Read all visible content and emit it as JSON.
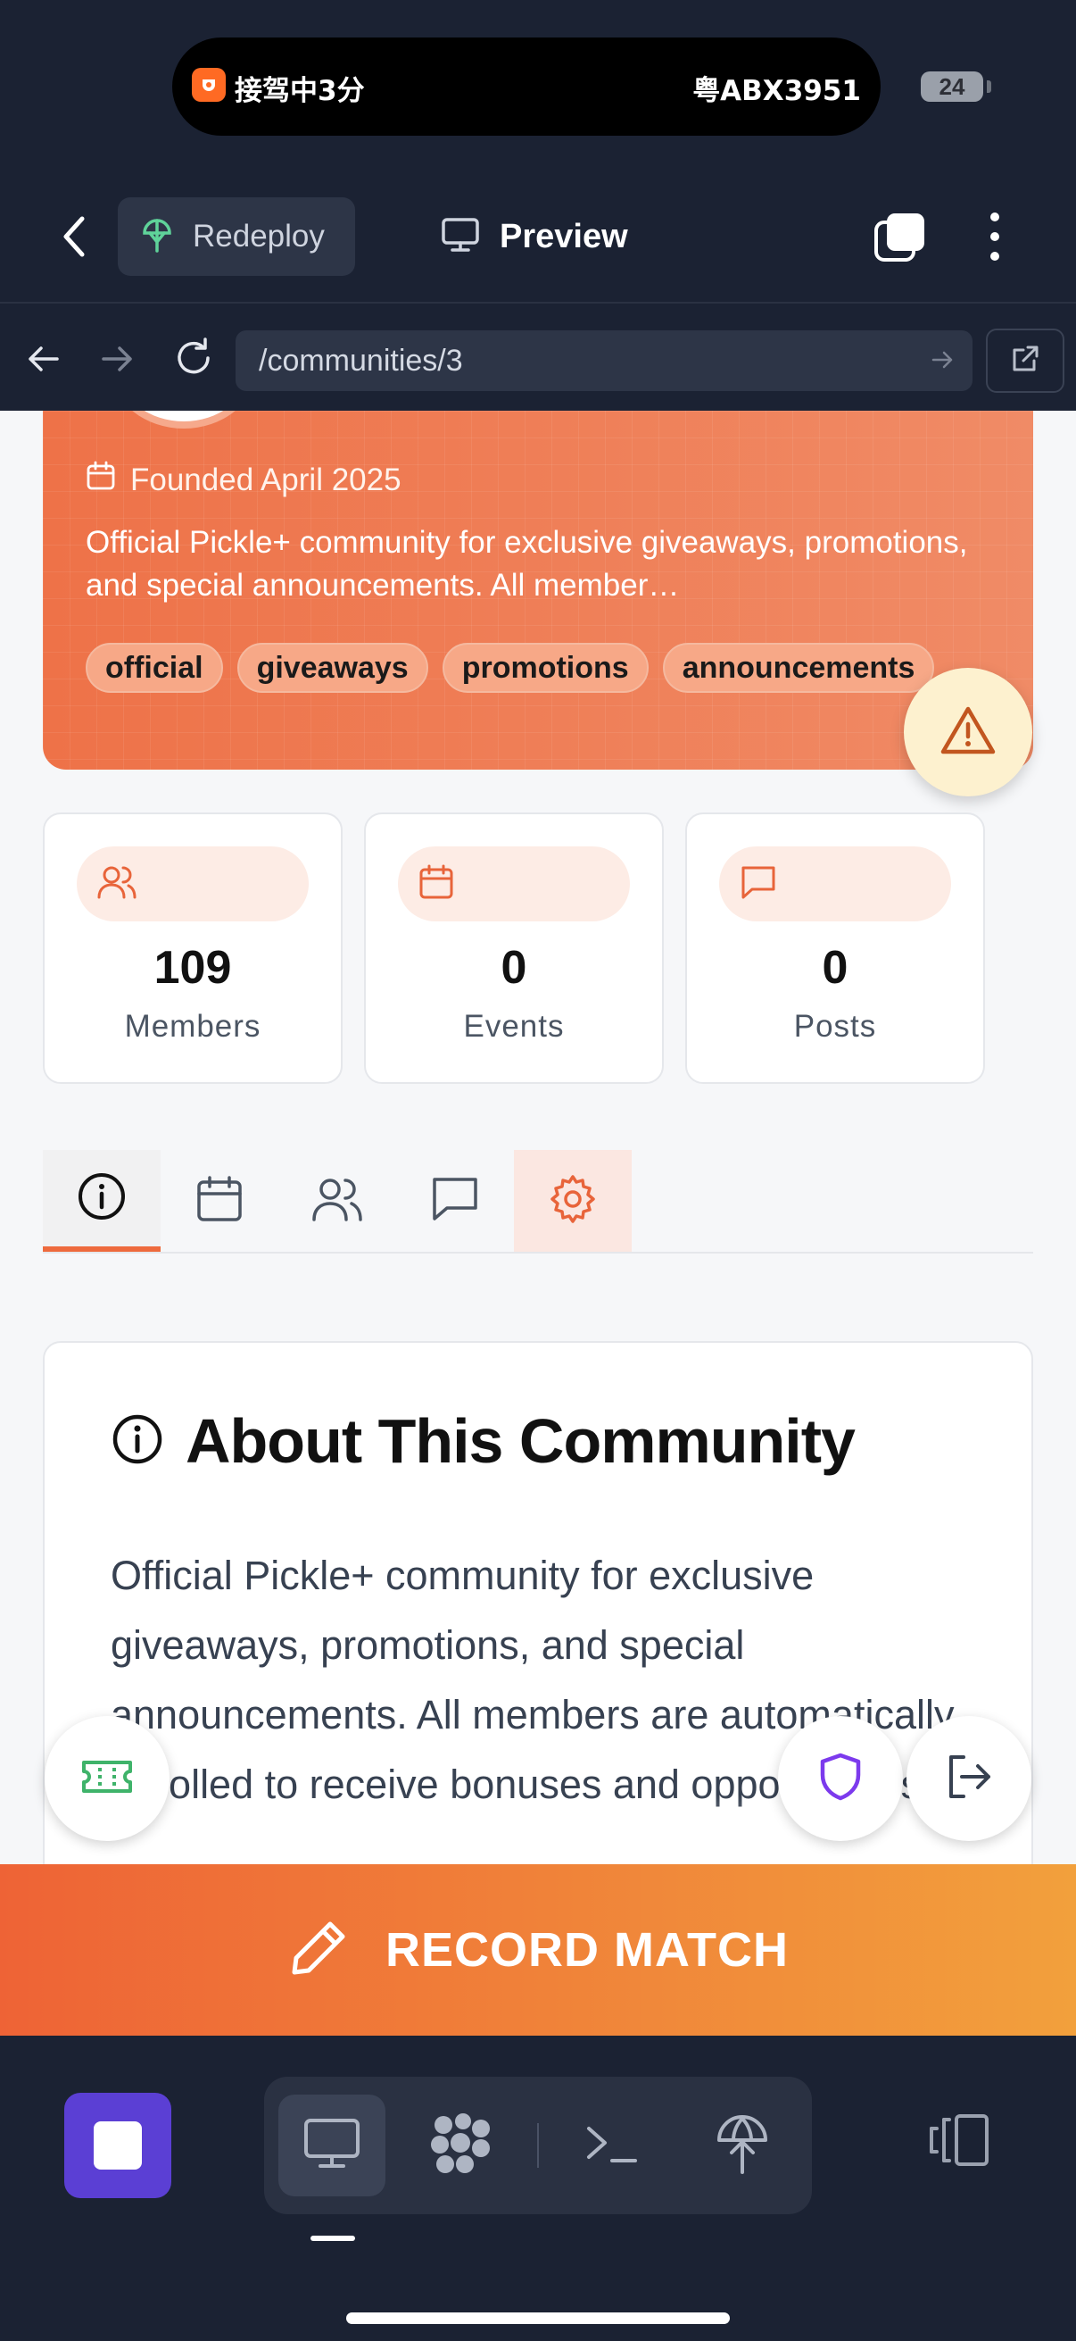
{
  "status_bar": {
    "activity_left": "接驾中3分",
    "activity_right": "粤ABX3951",
    "battery": "24"
  },
  "app_bar": {
    "redeploy_label": "Redeploy",
    "preview_label": "Preview"
  },
  "browser": {
    "url": "/communities/3"
  },
  "community": {
    "founded": "Founded April 2025",
    "description": "Official Pickle+ community for exclusive giveaways, promotions, and special announcements. All member…",
    "tags": [
      "official",
      "giveaways",
      "promotions",
      "announcements"
    ]
  },
  "stats": [
    {
      "value": "109",
      "label": "Members",
      "icon": "users-icon"
    },
    {
      "value": "0",
      "label": "Events",
      "icon": "calendar-icon"
    },
    {
      "value": "0",
      "label": "Posts",
      "icon": "message-icon"
    }
  ],
  "tabs": [
    {
      "icon": "info-icon",
      "active": true
    },
    {
      "icon": "calendar-icon",
      "active": false
    },
    {
      "icon": "users-icon",
      "active": false
    },
    {
      "icon": "message-icon",
      "active": false
    },
    {
      "icon": "gear-icon",
      "active": false
    }
  ],
  "about": {
    "title": "About This Community",
    "text": "Official Pickle+ community for exclusive giveaways, promotions, and special announcements. All members are automatically enrolled to receive bonuses and opportunities."
  },
  "record_match": {
    "label": "RECORD MATCH"
  },
  "colors": {
    "accent": "#ee6a3d",
    "dark_chrome": "#1b2233",
    "stop_purple": "#5b3fd4"
  }
}
